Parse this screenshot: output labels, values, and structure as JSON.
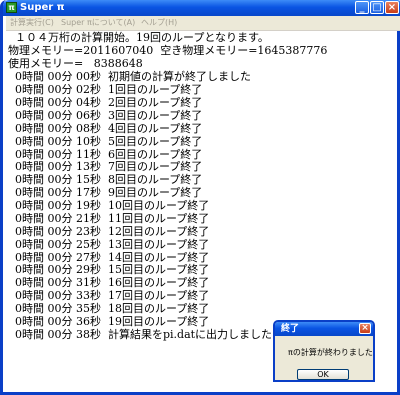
{
  "window": {
    "title": "Super π",
    "icon_glyph": "π",
    "controls": {
      "minimize": "_",
      "maximize": "□",
      "close": "×"
    }
  },
  "menu": [
    "計算実行(C)",
    "Super πについて(A)",
    "ヘルプ(H)"
  ],
  "console_lines": [
    "  １０４万桁の計算開始。19回のループとなります。",
    "物理メモリー=2011607040  空き物理メモリー=1645387776",
    "使用メモリー=   8388648",
    "  0時間 00分 00秒  初期値の計算が終了しました",
    "  0時間 00分 02秒  1回目のループ終了",
    "  0時間 00分 04秒  2回目のループ終了",
    "  0時間 00分 06秒  3回目のループ終了",
    "  0時間 00分 08秒  4回目のループ終了",
    "  0時間 00分 10秒  5回目のループ終了",
    "  0時間 00分 11秒  6回目のループ終了",
    "  0時間 00分 13秒  7回目のループ終了",
    "  0時間 00分 15秒  8回目のループ終了",
    "  0時間 00分 17秒  9回目のループ終了",
    "  0時間 00分 19秒  10回目のループ終了",
    "  0時間 00分 21秒  11回目のループ終了",
    "  0時間 00分 23秒  12回目のループ終了",
    "  0時間 00分 25秒  13回目のループ終了",
    "  0時間 00分 27秒  14回目のループ終了",
    "  0時間 00分 29秒  15回目のループ終了",
    "  0時間 00分 31秒  16回目のループ終了",
    "  0時間 00分 33秒  17回目のループ終了",
    "  0時間 00分 35秒  18回目のループ終了",
    "  0時間 00分 36秒  19回目のループ終了",
    "  0時間 00分 38秒  計算結果をpi.datに出力しました"
  ],
  "dialog": {
    "title": "終了",
    "message": "πの計算が終わりました",
    "ok_label": "OK",
    "close_glyph": "×"
  },
  "colors": {
    "titlebar": "#0a54e3",
    "menubar": "#ece9d8",
    "close_button": "#c73d18"
  }
}
